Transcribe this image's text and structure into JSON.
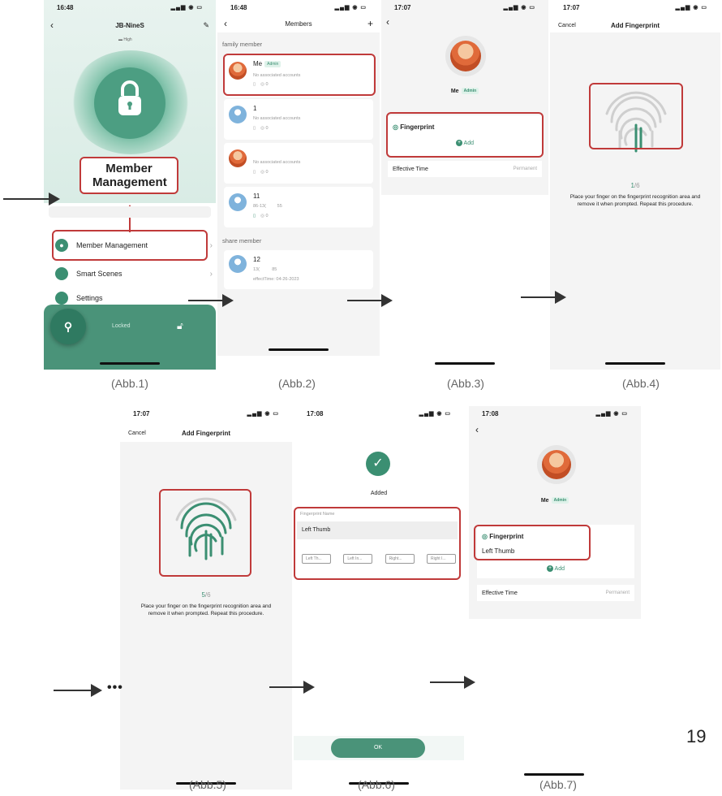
{
  "page_number": "19",
  "captions": [
    "(Abb.1)",
    "(Abb.2)",
    "(Abb.3)",
    "(Abb.4)",
    "(Abb.5)",
    "(Abb.6)",
    "(Abb.7)"
  ],
  "abb1": {
    "time": "16:48",
    "title": "JB-NineS",
    "battery": "High",
    "callout": "Member Management",
    "menu": [
      "Member Management",
      "Smart Scenes",
      "Settings"
    ],
    "lock_status": "Locked"
  },
  "abb2": {
    "time": "16:48",
    "title": "Members",
    "family_header": "family member",
    "members": [
      {
        "name": "Me",
        "badge": "Admin",
        "sub": "No associated accounts",
        "count": "0"
      },
      {
        "name": "1",
        "sub": "No associated accounts",
        "count": "0"
      },
      {
        "name": "",
        "sub": "No associated accounts",
        "count": "0"
      },
      {
        "name": "11",
        "sub_a": "86-13(",
        "sub_b": "55",
        "count": "0"
      }
    ],
    "share_header": "share member",
    "share": {
      "name": "12",
      "sub_a": "13(",
      "sub_b": "85",
      "effect": "effectTime: 04-26-2023"
    }
  },
  "abb3": {
    "time": "17:07",
    "name": "Me",
    "badge": "Admin",
    "fingerprint": "Fingerprint",
    "add": "Add",
    "effective_label": "Effective Time",
    "effective_value": "Permanent"
  },
  "abb4": {
    "time": "17:07",
    "cancel": "Cancel",
    "title": "Add Fingerprint",
    "progress_current": "1",
    "progress_total": "/6",
    "instruction": "Place your finger on the fingerprint recognition area and remove it when prompted. Repeat this procedure."
  },
  "abb5": {
    "time": "17:07",
    "cancel": "Cancel",
    "title": "Add Fingerprint",
    "progress_current": "5",
    "progress_total": "/6",
    "instruction": "Place your finger on the fingerprint recognition area and remove it when prompted. Repeat this procedure."
  },
  "abb6": {
    "time": "17:08",
    "added": "Added",
    "field_label": "Fingerprint Name",
    "field_value": "Left Thumb",
    "chips": [
      "Left Th...",
      "Left In...",
      "Right...",
      "Right I..."
    ],
    "ok": "OK"
  },
  "abb7": {
    "time": "17:08",
    "name": "Me",
    "badge": "Admin",
    "fingerprint": "Fingerprint",
    "entry": "Left Thumb",
    "add": "Add",
    "effective_label": "Effective Time",
    "effective_value": "Permanent"
  },
  "colors": {
    "accent": "#3b8f72",
    "highlight": "#c03a3a",
    "bottom_panel": "#4a9379"
  }
}
